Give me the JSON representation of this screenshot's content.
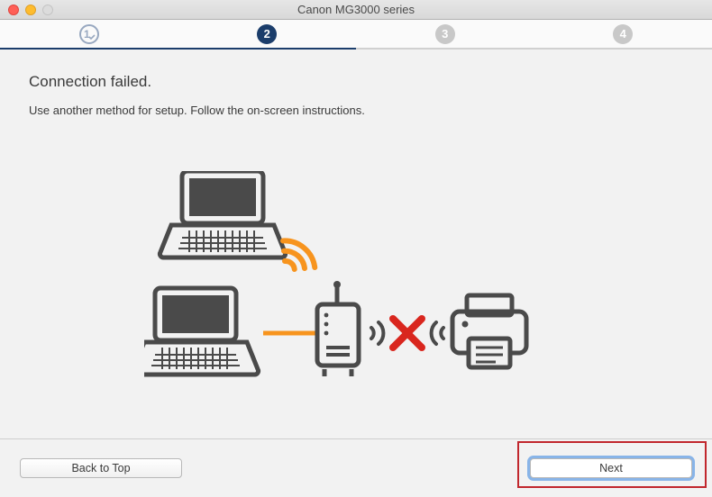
{
  "window": {
    "title": "Canon MG3000 series"
  },
  "steps": {
    "labels": [
      "1",
      "2",
      "3",
      "4"
    ]
  },
  "content": {
    "heading": "Connection failed.",
    "subtext": "Use another method for setup. Follow the on-screen instructions."
  },
  "footer": {
    "back_label": "Back to Top",
    "next_label": "Next"
  }
}
